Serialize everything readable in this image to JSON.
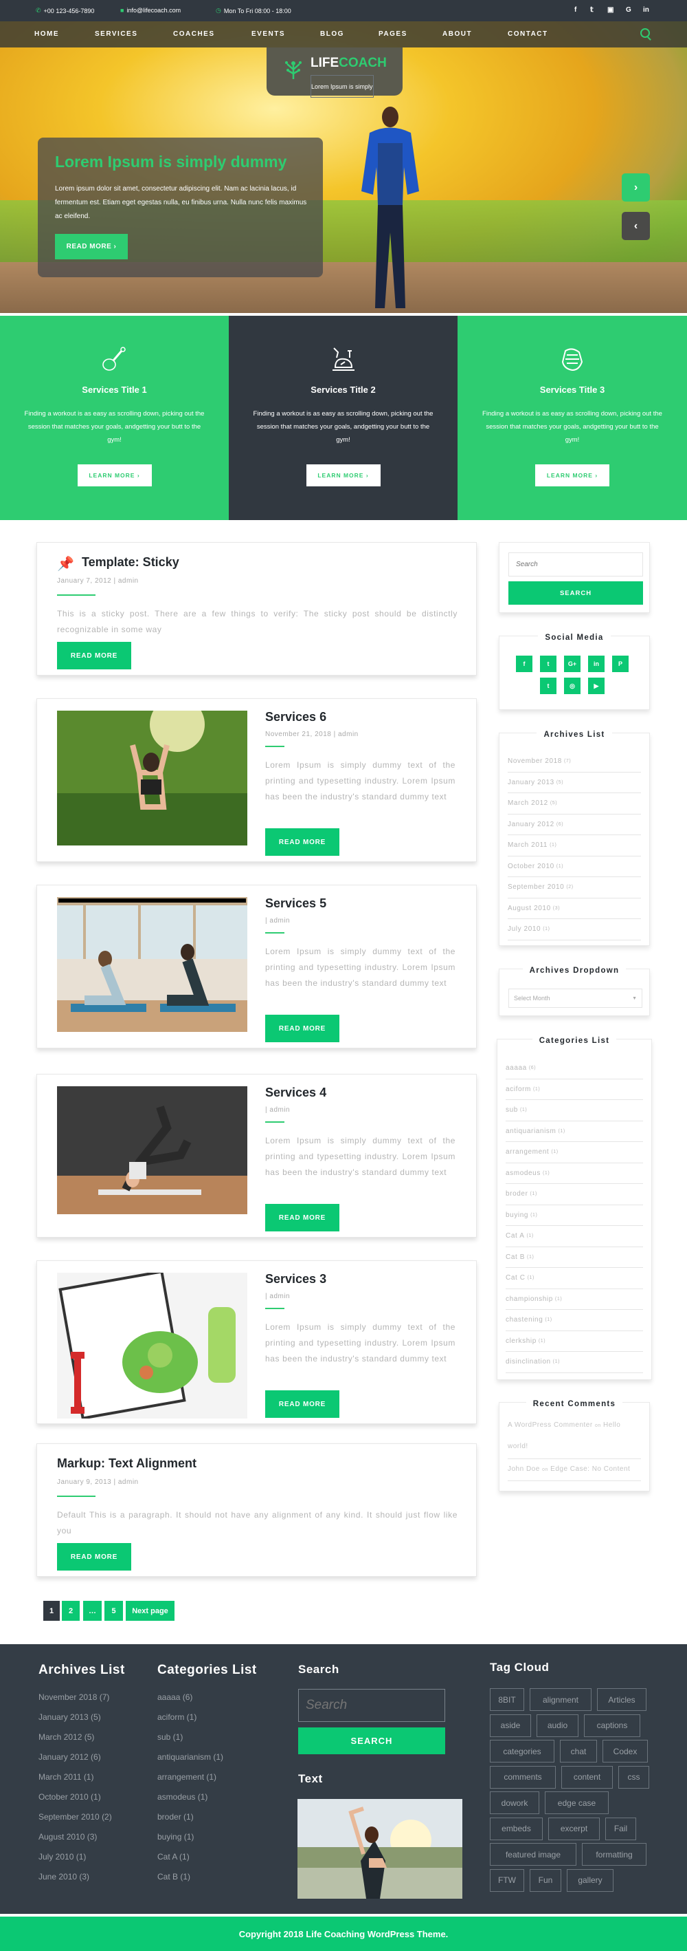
{
  "topbar": {
    "phone": "+00 123-456-7890",
    "email": "info@lifecoach.com",
    "hours": "Mon To Fri 08:00 - 18:00",
    "social": [
      "f",
      "t",
      "yt",
      "G",
      "in"
    ]
  },
  "nav": {
    "items": [
      "HOME",
      "SERVICES",
      "COACHES",
      "EVENTS",
      "BLOG",
      "PAGES",
      "ABOUT",
      "CONTACT"
    ],
    "active": "HOME"
  },
  "logo": {
    "brand_a": "LIFE",
    "brand_b": "COACH",
    "tagline": "Lorem Ipsum is simply"
  },
  "hero": {
    "title": "Lorem Ipsum is simply dummy",
    "text": "Lorem ipsum dolor sit amet, consectetur adipiscing elit. Nam ac lacinia lacus, id fermentum est. Etiam eget egestas nulla, eu finibus urna. Nulla nunc felis maximus ac eleifend.",
    "button": "READ MORE  ›",
    "next": "›",
    "prev": "‹"
  },
  "services": [
    {
      "title": "Services Title 1",
      "text": "Finding a workout is as easy as scrolling down, picking out the session that matches your goals, andgetting your butt to the gym!",
      "button": "LEARN MORE  ›",
      "icon": "drumstick-icon"
    },
    {
      "title": "Services Title 2",
      "text": "Finding a workout is as easy as scrolling down, picking out the session that matches your goals, andgetting your butt to the gym!",
      "button": "LEARN MORE  ›",
      "icon": "exercise-bike-icon"
    },
    {
      "title": "Services Title 3",
      "text": "Finding a workout is as easy as scrolling down, picking out the session that matches your goals, andgetting your butt to the gym!",
      "button": "LEARN MORE  ›",
      "icon": "arm-wrestling-icon"
    }
  ],
  "posts": [
    {
      "title": "Template: Sticky",
      "meta": "January 7, 2012 |  admin",
      "excerpt": "This is a sticky post. There are a few things to verify: The sticky post should be distinctly recognizable in some way",
      "button": "READ MORE"
    },
    {
      "title": "Services 6",
      "meta": "November 21, 2018 |  admin",
      "excerpt": "Lorem Ipsum is simply dummy text of the printing and typesetting industry. Lorem Ipsum has been the industry's standard dummy text",
      "button": "READ MORE"
    },
    {
      "title": "Services 5",
      "meta": " |  admin",
      "excerpt": "Lorem Ipsum is simply dummy text of the printing and typesetting industry. Lorem Ipsum has been the industry's standard dummy text",
      "button": "READ MORE"
    },
    {
      "title": "Services 4",
      "meta": " |  admin",
      "excerpt": "Lorem Ipsum is simply dummy text of the printing and typesetting industry. Lorem Ipsum has been the industry's standard dummy text",
      "button": "READ MORE"
    },
    {
      "title": "Services 3",
      "meta": " |  admin",
      "excerpt": "Lorem Ipsum is simply dummy text of the printing and typesetting industry. Lorem Ipsum has been the industry's standard dummy text",
      "button": "READ MORE"
    },
    {
      "title": "Markup: Text Alignment",
      "meta": "January 9, 2013 |  admin",
      "excerpt": "Default This is a paragraph. It should not have any alignment of any kind. It should just flow like you",
      "button": "READ MORE"
    }
  ],
  "pagination": {
    "pages": [
      "1",
      "2",
      "…",
      "5"
    ],
    "next": "Next page",
    "current": "1"
  },
  "sidebar": {
    "search": {
      "placeholder": "Search",
      "button": "SEARCH"
    },
    "social_title": "Social Media",
    "social": [
      "f",
      "t",
      "G+",
      "in",
      "p",
      "t",
      "ig",
      "yt"
    ],
    "archives_title": "Archives List",
    "archives": [
      {
        "label": "November 2018",
        "count": "(7)"
      },
      {
        "label": "January 2013",
        "count": "(5)"
      },
      {
        "label": "March 2012",
        "count": "(5)"
      },
      {
        "label": "January 2012",
        "count": "(6)"
      },
      {
        "label": "March 2011",
        "count": "(1)"
      },
      {
        "label": "October 2010",
        "count": "(1)"
      },
      {
        "label": "September 2010",
        "count": "(2)"
      },
      {
        "label": "August 2010",
        "count": "(3)"
      },
      {
        "label": "July 2010",
        "count": "(1)"
      }
    ],
    "dropdown_title": "Archives Dropdown",
    "dropdown_value": "Select Month",
    "categories_title": "Categories List",
    "categories": [
      {
        "label": "aaaaa",
        "count": "(6)"
      },
      {
        "label": "aciform",
        "count": "(1)"
      },
      {
        "label": "sub",
        "count": "(1)"
      },
      {
        "label": "antiquarianism",
        "count": "(1)"
      },
      {
        "label": "arrangement",
        "count": "(1)"
      },
      {
        "label": "asmodeus",
        "count": "(1)"
      },
      {
        "label": "broder",
        "count": "(1)"
      },
      {
        "label": "buying",
        "count": "(1)"
      },
      {
        "label": "Cat A",
        "count": "(1)"
      },
      {
        "label": "Cat B",
        "count": "(1)"
      },
      {
        "label": "Cat C",
        "count": "(1)"
      },
      {
        "label": "championship",
        "count": "(1)"
      },
      {
        "label": "chastening",
        "count": "(1)"
      },
      {
        "label": "clerkship",
        "count": "(1)"
      },
      {
        "label": "disinclination",
        "count": "(1)"
      }
    ],
    "comments_title": "Recent Comments",
    "comments": [
      {
        "author": "A WordPress Commenter",
        "on": "on",
        "post": "Hello world!"
      },
      {
        "author": "John Doe",
        "on": "on",
        "post": "Edge Case: No Content"
      }
    ]
  },
  "footer": {
    "archives_title": "Archives List",
    "archives": [
      "November 2018 (7)",
      "January 2013 (5)",
      "March 2012 (5)",
      "January 2012 (6)",
      "March 2011 (1)",
      "October 2010 (1)",
      "September 2010 (2)",
      "August 2010 (3)",
      "July 2010 (1)",
      "June 2010 (3)"
    ],
    "categories_title": "Categories List",
    "categories": [
      "aaaaa (6)",
      "aciform (1)",
      "sub (1)",
      "antiquarianism (1)",
      "arrangement (1)",
      "asmodeus (1)",
      "broder (1)",
      "buying (1)",
      "Cat A (1)",
      "Cat B (1)"
    ],
    "search_title": "Search",
    "search_placeholder": "Search",
    "search_button": "SEARCH",
    "text_title": "Text",
    "tags_title": "Tag Cloud",
    "tags": [
      "8BIT",
      "alignment",
      "Articles",
      "aside",
      "audio",
      "captions",
      "categories",
      "chat",
      "Codex",
      "comments",
      "content",
      "css",
      "dowork",
      "edge case",
      "Fail",
      "embeds",
      "excerpt",
      "Fail",
      "featured image",
      "formatting",
      "FTW",
      "Fun",
      "gallery"
    ],
    "copyright": "Copyright 2018 Life Coaching WordPress Theme."
  },
  "colors": {
    "accent": "#2ecc71",
    "button": "#0bc873",
    "dark": "#313840",
    "footer": "#343d46"
  }
}
